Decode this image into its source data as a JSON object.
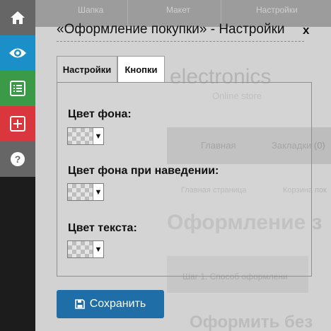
{
  "toolbar": {
    "items": [
      {
        "icon": "home-icon",
        "color": "#666666"
      },
      {
        "icon": "eye-icon",
        "color": "#1a8fc8"
      },
      {
        "icon": "list-icon",
        "color": "#3a9a48"
      },
      {
        "icon": "plus-square-icon",
        "color": "#d9363e"
      },
      {
        "icon": "help-icon",
        "color": "#666666"
      }
    ]
  },
  "background_site": {
    "top_items": [
      "Шапка",
      "Макет",
      "Настройки"
    ],
    "logo_text": "electronics",
    "logo_sub": "Online store",
    "nav": [
      "Главная",
      "Закладки (0)"
    ],
    "breadcrumbs": [
      "Главная страница",
      "Корзина пок"
    ],
    "heading": "Оформление з",
    "step": "Шаг 1. Способ оформлени",
    "heading2": "Оформить без"
  },
  "panel": {
    "title": "«Оформление покупки» - Настройки",
    "close_label": "x",
    "tabs": [
      {
        "label": "Настройки",
        "active": false
      },
      {
        "label": "Кнопки",
        "active": true
      }
    ],
    "fields": [
      {
        "label": "Цвет фона:",
        "value": "transparent"
      },
      {
        "label": "Цвет фона при наведении:",
        "value": "transparent"
      },
      {
        "label": "Цвет текста:",
        "value": "transparent"
      }
    ],
    "picker_arrow": "▼",
    "save_label": "Сохранить",
    "save_color": "#1f6ea8"
  }
}
